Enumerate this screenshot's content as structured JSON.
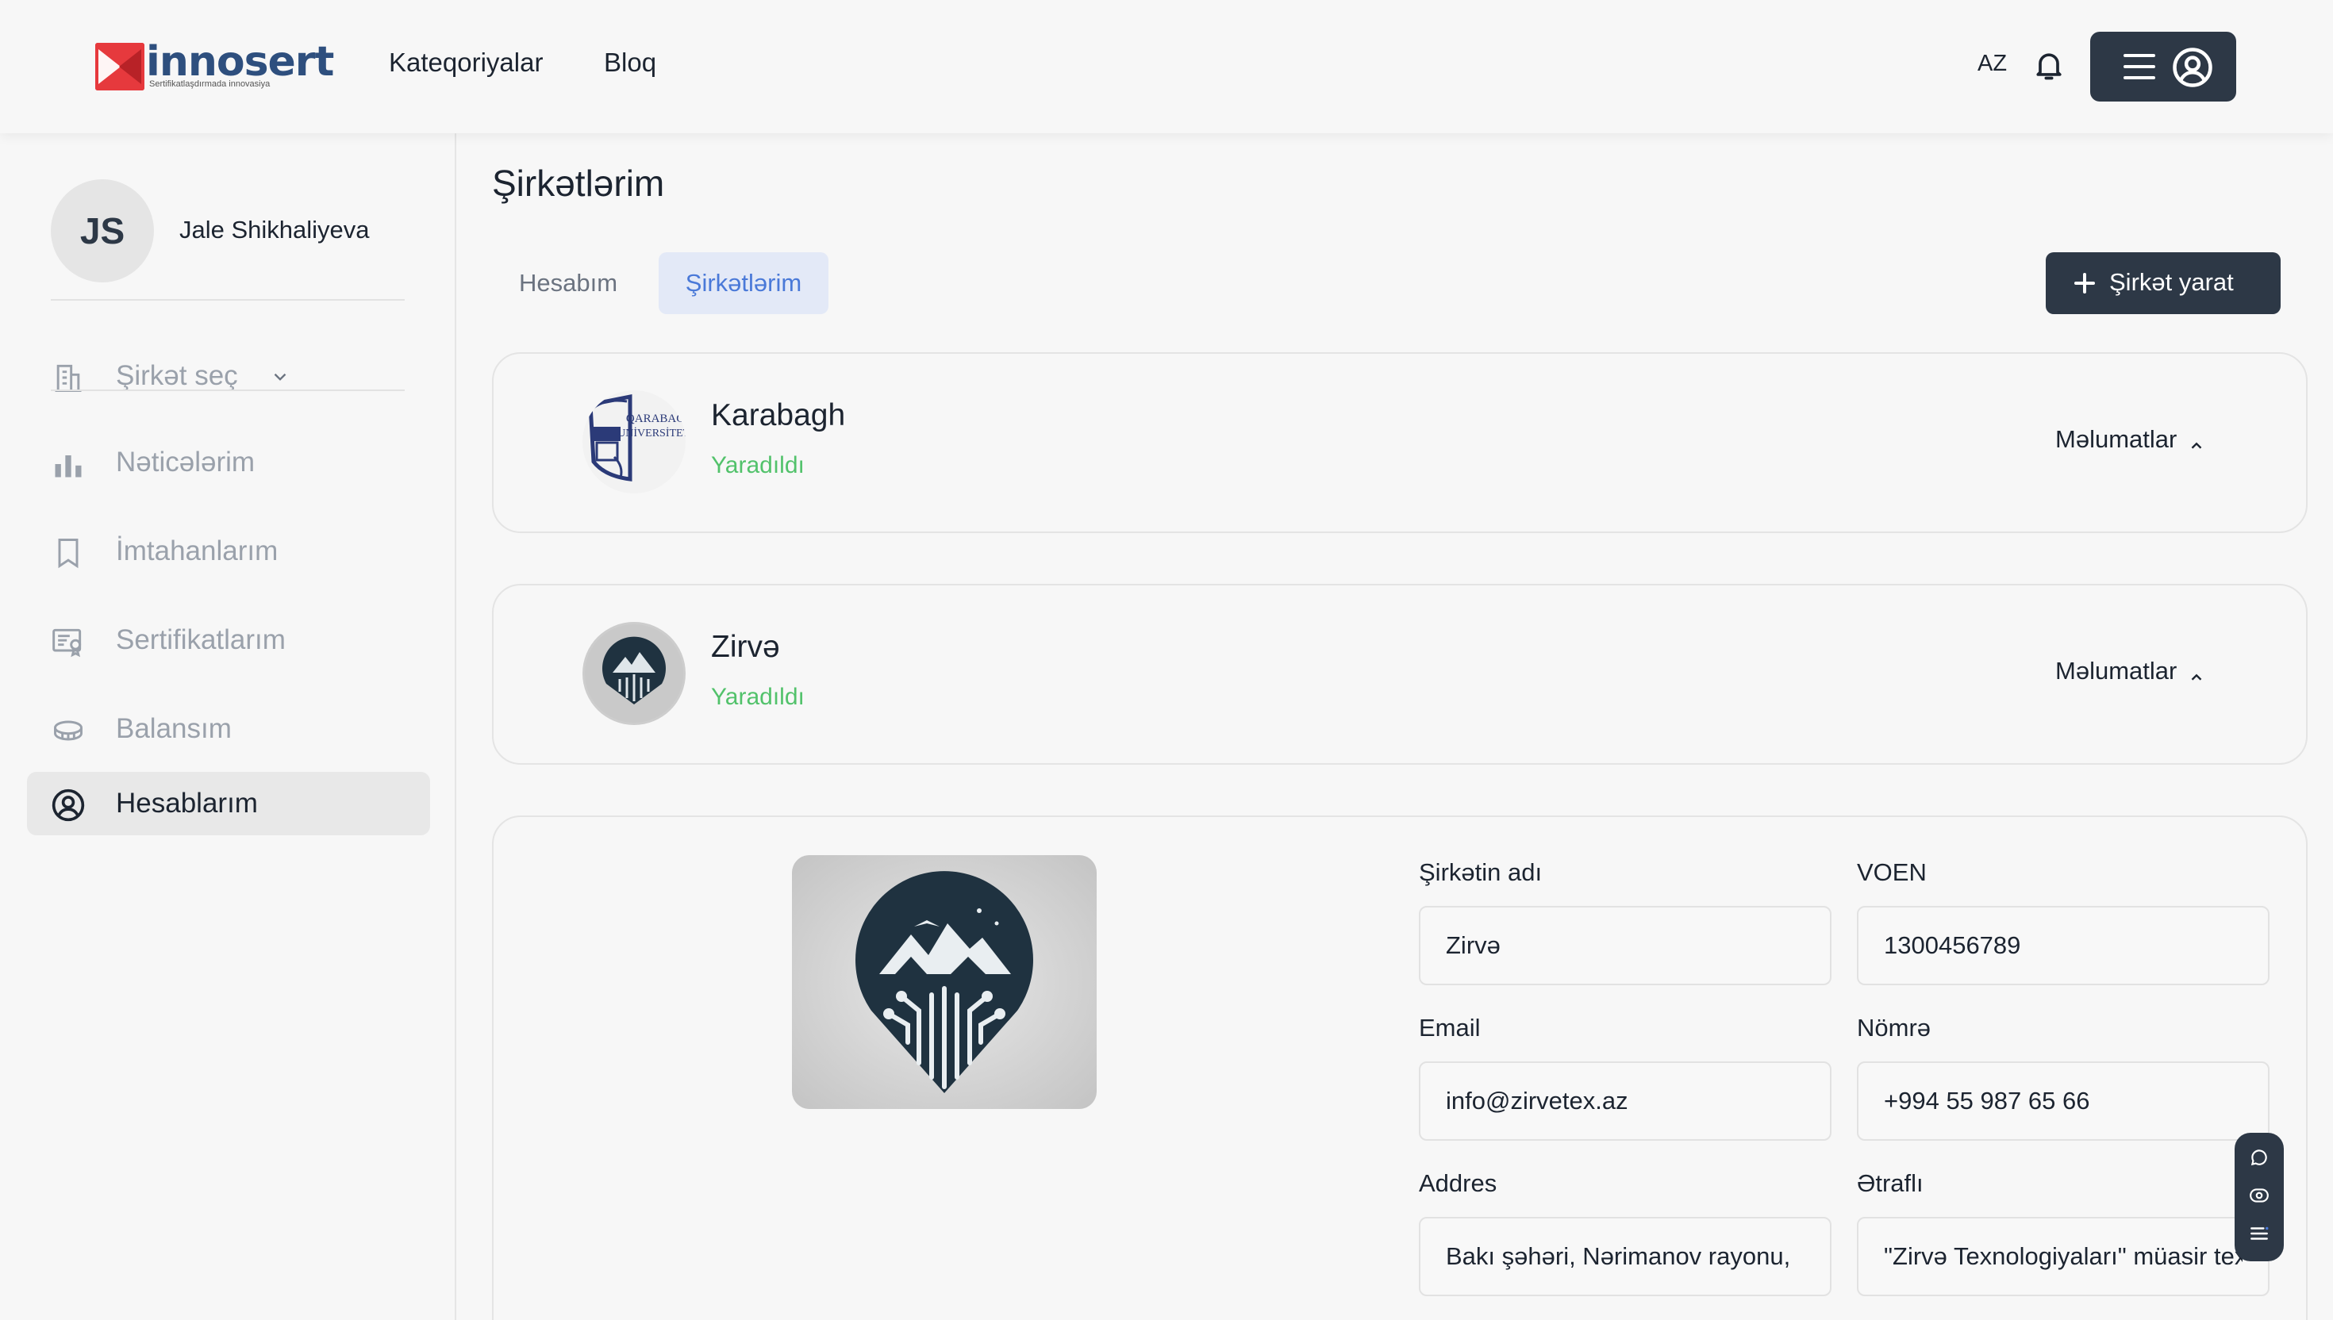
{
  "header": {
    "logo": {
      "word": "innosert",
      "tagline": "Sertifikatlaşdırmada innovasiya"
    },
    "nav": [
      "Kateqoriyalar",
      "Bloq"
    ],
    "language": "AZ",
    "icons": {
      "notifications": "bell-icon",
      "menu": "hamburger-icon",
      "profile": "user-circle-icon"
    }
  },
  "sidebar": {
    "user": {
      "initials": "JS",
      "name": "Jale Shikhaliyeva"
    },
    "company_select": {
      "label": "Şirkət seç",
      "icon": "building-icon"
    },
    "items": [
      {
        "label": "Nəticələrim",
        "icon": "bar-chart-icon",
        "active": false
      },
      {
        "label": "İmtahanlarım",
        "icon": "bookmark-icon",
        "active": false
      },
      {
        "label": "Sertifikatlarım",
        "icon": "certificate-icon",
        "active": false
      },
      {
        "label": "Balansım",
        "icon": "coins-icon",
        "active": false
      },
      {
        "label": "Hesablarım",
        "icon": "user-circle-icon",
        "active": true
      }
    ]
  },
  "main": {
    "title": "Şirkətlərim",
    "tabs": [
      {
        "label": "Hesabım",
        "active": false
      },
      {
        "label": "Şirkətlərim",
        "active": true
      }
    ],
    "create_button": "Şirkət yarat",
    "companies": [
      {
        "name": "Karabagh",
        "status": "Yaradıldı",
        "details_label": "Məlumatlar",
        "logo_text": [
          "QARABAĞ",
          "UNİVERSİTETİ"
        ]
      },
      {
        "name": "Zirvə",
        "status": "Yaradıldı",
        "details_label": "Məlumatlar"
      }
    ],
    "details_form": {
      "fields": [
        {
          "label": "Şirkətin adı",
          "value": "Zirvə"
        },
        {
          "label": "VOEN",
          "value": "1300456789"
        },
        {
          "label": "Email",
          "value": "info@zirvetex.az"
        },
        {
          "label": "Nömrə",
          "value": "+994 55 987 65 66"
        },
        {
          "label": "Addres",
          "value": "Bakı şəhəri, Nərimanov rayonu,"
        },
        {
          "label": "Ətraflı",
          "value": "\"Zirvə Texnologiyaları\" müasir texnologiya"
        }
      ]
    }
  },
  "colors": {
    "primary_dark": "#2d3846",
    "accent_blue": "#4a79d8",
    "status_green": "#52c26b",
    "logo_red": "#e6393d",
    "logo_blue": "#2e4f7e"
  }
}
